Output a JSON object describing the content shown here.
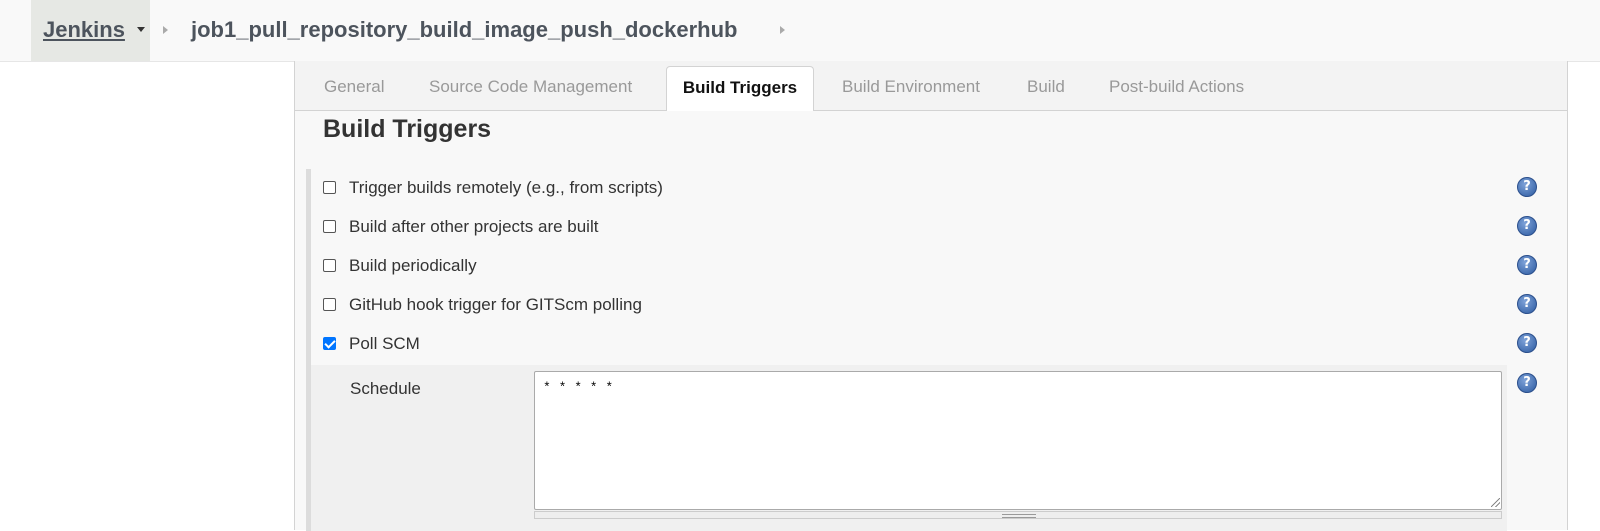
{
  "breadcrumb": {
    "root": "Jenkins",
    "job": "job1_pull_repository_build_image_push_dockerhub"
  },
  "tabs": [
    {
      "label": "General",
      "active": false
    },
    {
      "label": "Source Code Management",
      "active": false
    },
    {
      "label": "Build Triggers",
      "active": true
    },
    {
      "label": "Build Environment",
      "active": false
    },
    {
      "label": "Build",
      "active": false
    },
    {
      "label": "Post-build Actions",
      "active": false
    }
  ],
  "section": {
    "title": "Build Triggers"
  },
  "triggers": [
    {
      "label": "Trigger builds remotely (e.g., from scripts)",
      "checked": false
    },
    {
      "label": "Build after other projects are built",
      "checked": false
    },
    {
      "label": "Build periodically",
      "checked": false
    },
    {
      "label": "GitHub hook trigger for GITScm polling",
      "checked": false
    },
    {
      "label": "Poll SCM",
      "checked": true
    }
  ],
  "schedule": {
    "label": "Schedule",
    "value": "* * * * *"
  },
  "help_icon": {
    "glyph": "?",
    "icon": "help-icon"
  },
  "colors": {
    "accent": "#0075ff",
    "help": "#2c5aa0",
    "tab_inactive": "#999999"
  }
}
